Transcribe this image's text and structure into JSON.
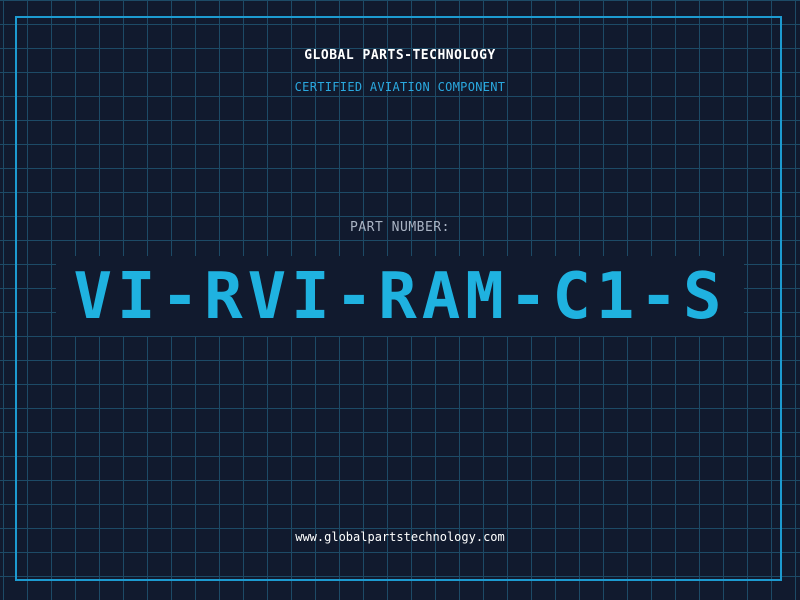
{
  "header": {
    "company": "GLOBAL PARTS-TECHNOLOGY",
    "subtitle": "CERTIFIED AVIATION COMPONENT"
  },
  "part": {
    "label": "PART NUMBER:",
    "number": "VI-RVI-RAM-C1-S"
  },
  "footer": {
    "url": "www.globalpartstechnology.com"
  },
  "colors": {
    "background": "#111a2e",
    "grid": "#1d4a66",
    "frame": "#1d9ad0",
    "accent": "#1fb2e0",
    "subtitle": "#2aa8df",
    "label": "#aab4c4",
    "text": "#ffffff"
  }
}
